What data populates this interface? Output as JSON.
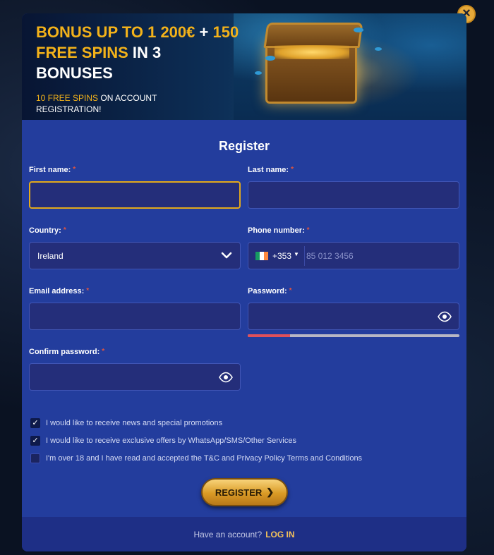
{
  "banner": {
    "headline_part1": "BONUS UP TO 1 200€",
    "headline_part2": " + ",
    "headline_part3": "150 FREE SPINS",
    "headline_part4": " IN 3 BONUSES",
    "sub_part1": "10 FREE SPINS",
    "sub_part2": " ON ACCOUNT REGISTRATION!"
  },
  "close_label": "×",
  "form": {
    "title": "Register",
    "required_mark": "*",
    "first_name_label": "First name:",
    "last_name_label": "Last name:",
    "country_label": "Country:",
    "country_value": "Ireland",
    "phone_label": "Phone number:",
    "phone_dial_code": "+353",
    "phone_caret": "▼",
    "phone_placeholder": "85 012 3456",
    "email_label": "Email address:",
    "password_label": "Password:",
    "confirm_password_label": "Confirm password:",
    "password_strength": 0.2
  },
  "consents": [
    {
      "text": "I would like to receive news and special promotions",
      "checked": true
    },
    {
      "text": "I would like to receive exclusive offers by WhatsApp/SMS/Other Services",
      "checked": true
    },
    {
      "text_prefix": "I'm over 18 and I have read and accepted the T&C and Privacy Policy ",
      "link": "Terms and Conditions",
      "checked": false
    }
  ],
  "checkmark": "✓",
  "register_button": {
    "label": "REGISTER",
    "arrow": "❯"
  },
  "footer": {
    "question": "Have an account?",
    "login": "LOG IN"
  },
  "colors": {
    "accent_gold": "#f3b21a",
    "panel_blue": "#233d9d",
    "field_bg": "#242e7a",
    "strength_red": "#e0505a"
  },
  "icons": [
    "close-icon",
    "chevron-down-icon",
    "ireland-flag-icon",
    "eye-icon",
    "check-icon",
    "arrow-right-icon"
  ]
}
